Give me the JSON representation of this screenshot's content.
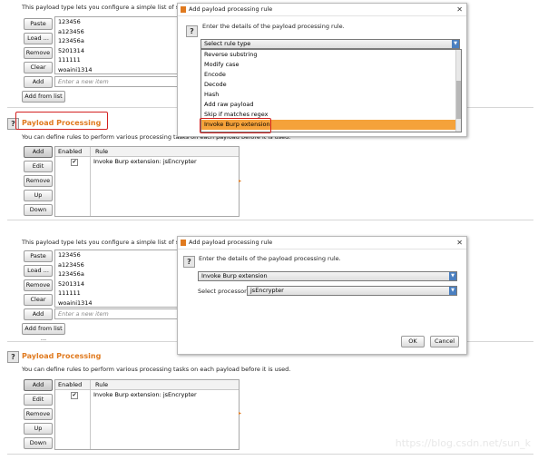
{
  "top": {
    "description": "This payload type lets you configure a simple list of strings",
    "buttons": {
      "paste": "Paste",
      "load": "Load ...",
      "remove": "Remove",
      "clear": "Clear",
      "add": "Add",
      "add_from_list": "Add from list ..."
    },
    "list_items": [
      "123456",
      "a123456",
      "123456a",
      "5201314",
      "111111",
      "woaini1314"
    ],
    "new_item_placeholder": "Enter a new item",
    "section_title": "Payload Processing",
    "section_desc": "You can define rules to perform various processing tasks on each payload before it is used.",
    "proc_buttons": {
      "add": "Add",
      "edit": "Edit",
      "remove": "Remove",
      "up": "Up",
      "down": "Down"
    },
    "table": {
      "col_enabled": "Enabled",
      "col_rule": "Rule",
      "rows": [
        {
          "enabled": "✔",
          "rule": "Invoke Burp extension: jsEncrypter"
        }
      ]
    },
    "dialog": {
      "title": "Add payload processing rule",
      "prompt": "Enter the details of the payload processing rule.",
      "select_value": "Select rule type",
      "options": [
        "Reverse substring",
        "Modify case",
        "Encode",
        "Decode",
        "Hash",
        "Add raw payload",
        "Skip if matches regex",
        "Invoke Burp extension"
      ]
    }
  },
  "bottom": {
    "description": "This payload type lets you configure a simple list of strings",
    "buttons": {
      "paste": "Paste",
      "load": "Load ...",
      "remove": "Remove",
      "clear": "Clear",
      "add": "Add",
      "add_from_list": "Add from list ..."
    },
    "list_items": [
      "123456",
      "a123456",
      "123456a",
      "5201314",
      "111111",
      "woaini1314"
    ],
    "new_item_placeholder": "Enter a new item",
    "section_title": "Payload Processing",
    "section_desc": "You can define rules to perform various processing tasks on each payload before it is used.",
    "proc_buttons": {
      "add": "Add",
      "edit": "Edit",
      "remove": "Remove",
      "up": "Up",
      "down": "Down"
    },
    "table": {
      "col_enabled": "Enabled",
      "col_rule": "Rule",
      "rows": [
        {
          "enabled": "✔",
          "rule": "Invoke Burp extension: jsEncrypter"
        }
      ]
    },
    "dialog": {
      "title": "Add payload processing rule",
      "prompt": "Enter the details of the payload processing rule.",
      "rule_type_value": "Invoke Burp extension",
      "processor_label": "Select processor:",
      "processor_value": "jsEncrypter",
      "ok": "OK",
      "cancel": "Cancel"
    }
  },
  "watermark": "https://blog.csdn.net/sun_k",
  "colors": {
    "accent": "#e07a1f",
    "highlight": "#f5a23a",
    "annotation": "#d32020"
  }
}
